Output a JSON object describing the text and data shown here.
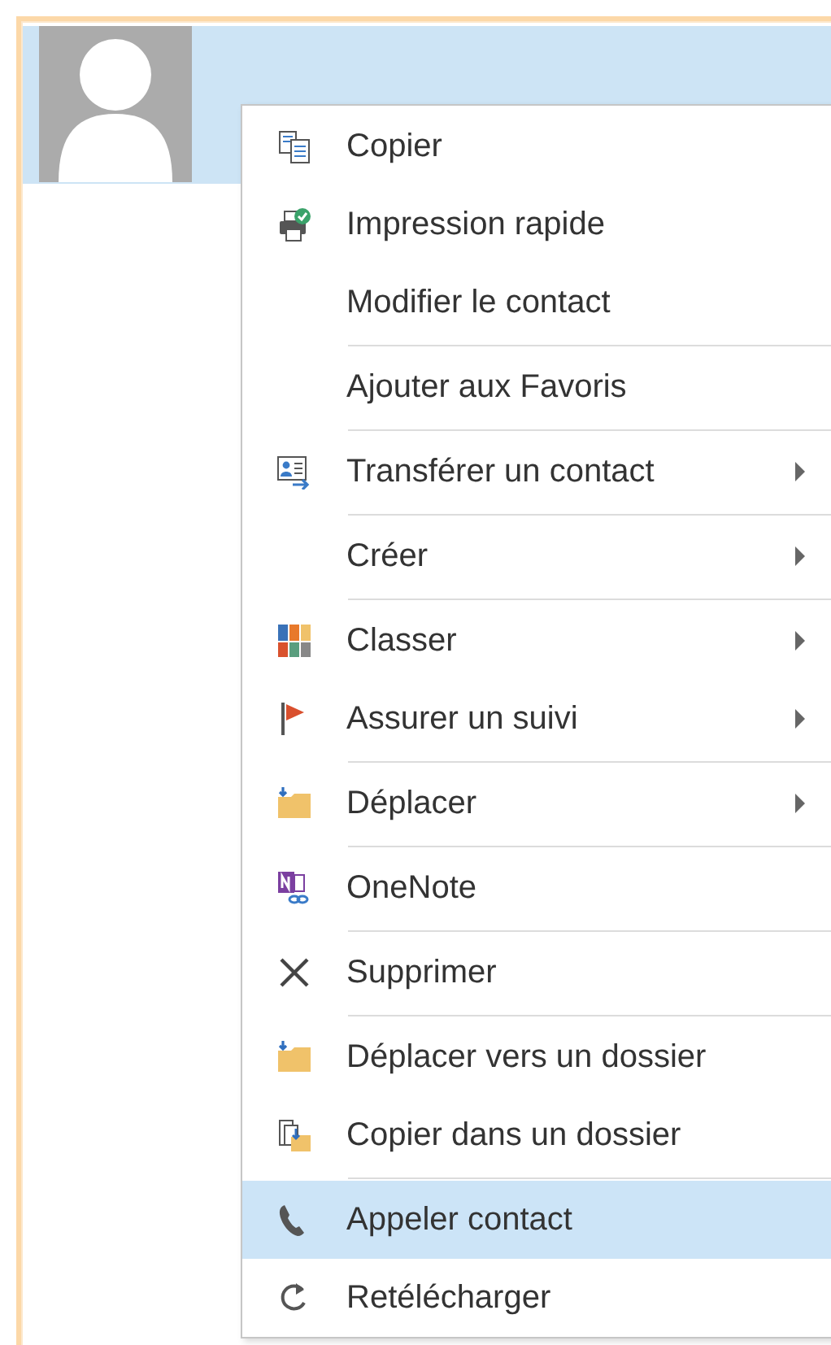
{
  "menu": {
    "items": [
      {
        "kind": "item",
        "label": "Copier",
        "submenu": false,
        "selected": false
      },
      {
        "kind": "item",
        "label": "Impression rapide",
        "submenu": false,
        "selected": false
      },
      {
        "kind": "item",
        "label": "Modifier le contact",
        "submenu": false,
        "selected": false
      },
      {
        "kind": "separator"
      },
      {
        "kind": "item",
        "label": "Ajouter aux Favoris",
        "submenu": false,
        "selected": false
      },
      {
        "kind": "separator"
      },
      {
        "kind": "item",
        "label": "Transférer un contact",
        "submenu": true,
        "selected": false
      },
      {
        "kind": "separator"
      },
      {
        "kind": "item",
        "label": "Créer",
        "submenu": true,
        "selected": false
      },
      {
        "kind": "separator"
      },
      {
        "kind": "item",
        "label": "Classer",
        "submenu": true,
        "selected": false
      },
      {
        "kind": "item",
        "label": "Assurer un suivi",
        "submenu": true,
        "selected": false
      },
      {
        "kind": "separator"
      },
      {
        "kind": "item",
        "label": "Déplacer",
        "submenu": true,
        "selected": false
      },
      {
        "kind": "separator"
      },
      {
        "kind": "item",
        "label": "OneNote",
        "submenu": false,
        "selected": false
      },
      {
        "kind": "separator"
      },
      {
        "kind": "item",
        "label": "Supprimer",
        "submenu": false,
        "selected": false
      },
      {
        "kind": "separator"
      },
      {
        "kind": "item",
        "label": "Déplacer vers un dossier",
        "submenu": false,
        "selected": false
      },
      {
        "kind": "item",
        "label": "Copier dans un dossier",
        "submenu": false,
        "selected": false
      },
      {
        "kind": "separator"
      },
      {
        "kind": "item",
        "label": "Appeler contact",
        "submenu": false,
        "selected": true
      },
      {
        "kind": "item",
        "label": "Retélécharger",
        "submenu": false,
        "selected": false
      }
    ]
  }
}
